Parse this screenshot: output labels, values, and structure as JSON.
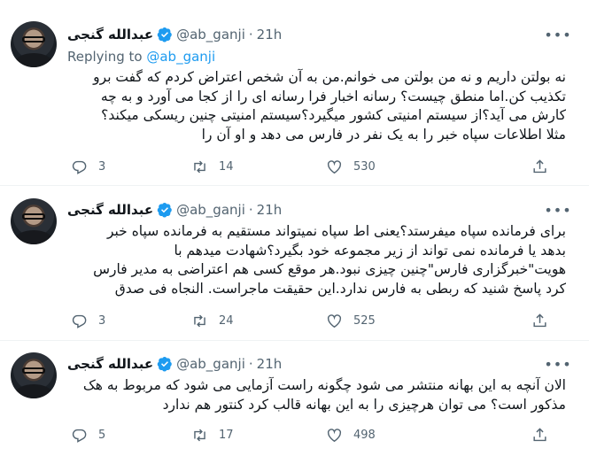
{
  "colors": {
    "accent": "#1d9bf0",
    "muted": "#536471",
    "text": "#0f1419",
    "divider": "#eff3f4"
  },
  "tweets": [
    {
      "name": "عبدالله گنجی",
      "handle": "@ab_ganji",
      "separator": "·",
      "time": "21h",
      "replying_label": "Replying to",
      "replying_to": "@ab_ganji",
      "lines": [
        "نه بولتن داریم و نه من بولتن می خوانم.من به آن شخص اعتراض کردم که گفت برو",
        "تکذیب کن.اما منطق چیست؟ رسانه اخبار فرا رسانه ای را از کجا می آورد و به چه",
        "کارش می آید؟از سیستم امنیتی کشور میگیرد؟سیستم امنیتی چنین ریسکی میکند؟",
        "مثلا اطلاعات سپاه خبر را به یک نفر در فارس می دهد و او آن را"
      ],
      "replies": "3",
      "retweets": "14",
      "likes": "530"
    },
    {
      "name": "عبدالله گنجی",
      "handle": "@ab_ganji",
      "separator": "·",
      "time": "21h",
      "lines": [
        "برای فرمانده سپاه میفرستد؟یعنی اط سپاه نمیتواند مستقیم به فرمانده سپاه خبر",
        "بدهد یا فرمانده نمی تواند از زیر مجموعه خود بگیرد؟شهادت میدهم با",
        "هویت\"خبرگزاری فارس\"چنین چیزی نبود.هر موقع کسی هم اعتراضی به مدیر فارس",
        "کرد پاسخ شنید که ربطی به فارس ندارد.این حقیقت ماجراست. النجاه فی صدق"
      ],
      "replies": "3",
      "retweets": "24",
      "likes": "525"
    },
    {
      "name": "عبدالله گنجی",
      "handle": "@ab_ganji",
      "separator": "·",
      "time": "21h",
      "lines": [
        "الان آنچه به این بهانه منتشر می شود چگونه راست آزمایی می شود که مربوط به هک",
        "مذکور است؟ می توان هرچیزی را به این بهانه قالب کرد کنتور هم ندارد"
      ],
      "replies": "5",
      "retweets": "17",
      "likes": "498"
    }
  ]
}
